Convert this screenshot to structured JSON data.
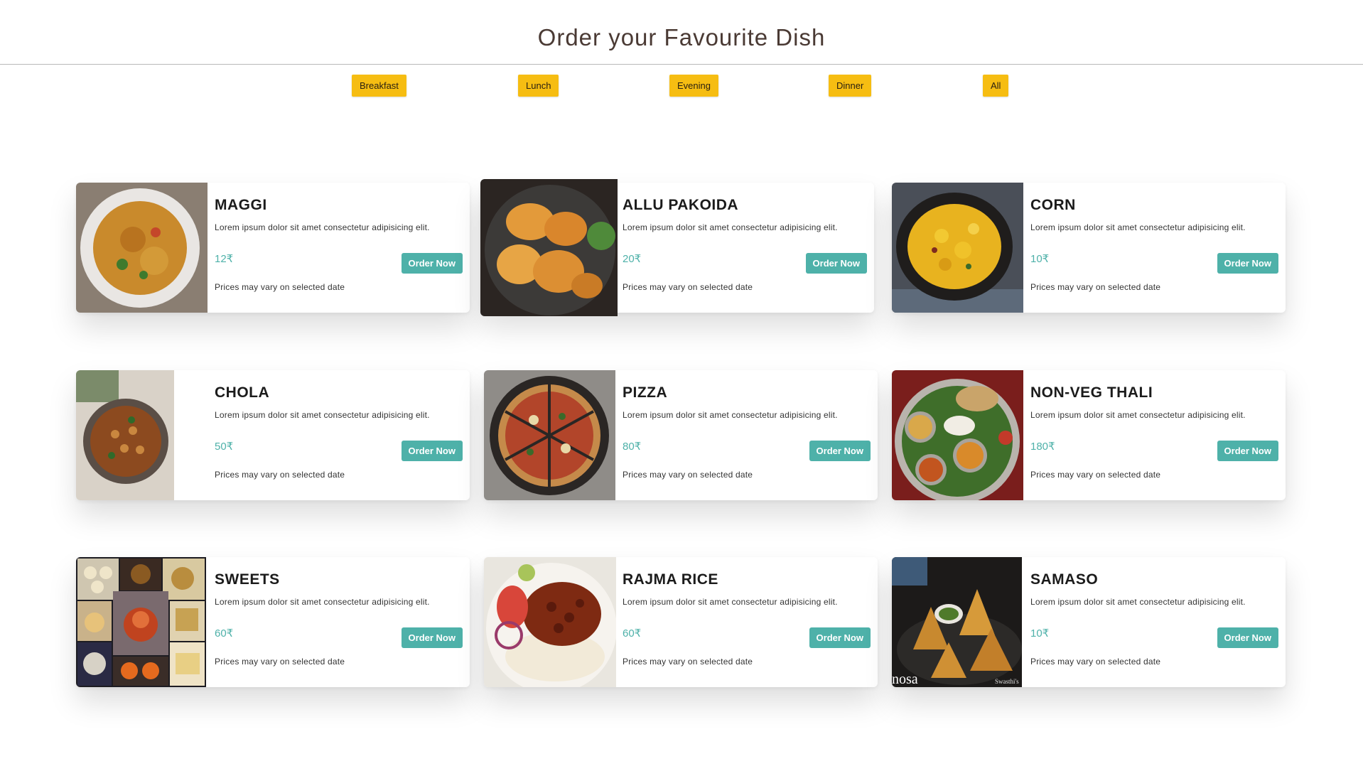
{
  "header": {
    "title": "Order your Favourite Dish"
  },
  "filters": [
    {
      "label": "Breakfast"
    },
    {
      "label": "Lunch"
    },
    {
      "label": "Evening"
    },
    {
      "label": "Dinner"
    },
    {
      "label": "All"
    }
  ],
  "menu": [
    {
      "name": "MAGGI",
      "description": "Lorem ipsum dolor sit amet consectetur adipisicing elit.",
      "price": "12₹",
      "button": "Order Now",
      "note": "Prices may vary on selected date"
    },
    {
      "name": "ALLU PAKOIDA",
      "description": "Lorem ipsum dolor sit amet consectetur adipisicing elit.",
      "price": "20₹",
      "button": "Order Now",
      "note": "Prices may vary on selected date"
    },
    {
      "name": "CORN",
      "description": "Lorem ipsum dolor sit amet consectetur adipisicing elit.",
      "price": "10₹",
      "button": "Order Now",
      "note": "Prices may vary on selected date"
    },
    {
      "name": "CHOLA",
      "description": "Lorem ipsum dolor sit amet consectetur adipisicing elit.",
      "price": "50₹",
      "button": "Order Now",
      "note": "Prices may vary on selected date"
    },
    {
      "name": "PIZZA",
      "description": "Lorem ipsum dolor sit amet consectetur adipisicing elit.",
      "price": "80₹",
      "button": "Order Now",
      "note": "Prices may vary on selected date"
    },
    {
      "name": "NON-VEG THALI",
      "description": "Lorem ipsum dolor sit amet consectetur adipisicing elit.",
      "price": "180₹",
      "button": "Order Now",
      "note": "Prices may vary on selected date"
    },
    {
      "name": "SWEETS",
      "description": "Lorem ipsum dolor sit amet consectetur adipisicing elit.",
      "price": "60₹",
      "button": "Order Now",
      "note": "Prices may vary on selected date"
    },
    {
      "name": "RAJMA RICE",
      "description": "Lorem ipsum dolor sit amet consectetur adipisicing elit.",
      "price": "60₹",
      "button": "Order Now",
      "note": "Prices may vary on selected date"
    },
    {
      "name": "SAMASO",
      "description": "Lorem ipsum dolor sit amet consectetur adipisicing elit.",
      "price": "10₹",
      "button": "Order Now",
      "note": "Prices may vary on selected date",
      "photo_caption": "nosa",
      "photo_watermark": "Swasthi's"
    }
  ],
  "colors": {
    "accent": "#4eb1a9",
    "filter_button": "#f6bd12",
    "title": "#4a3a34"
  }
}
